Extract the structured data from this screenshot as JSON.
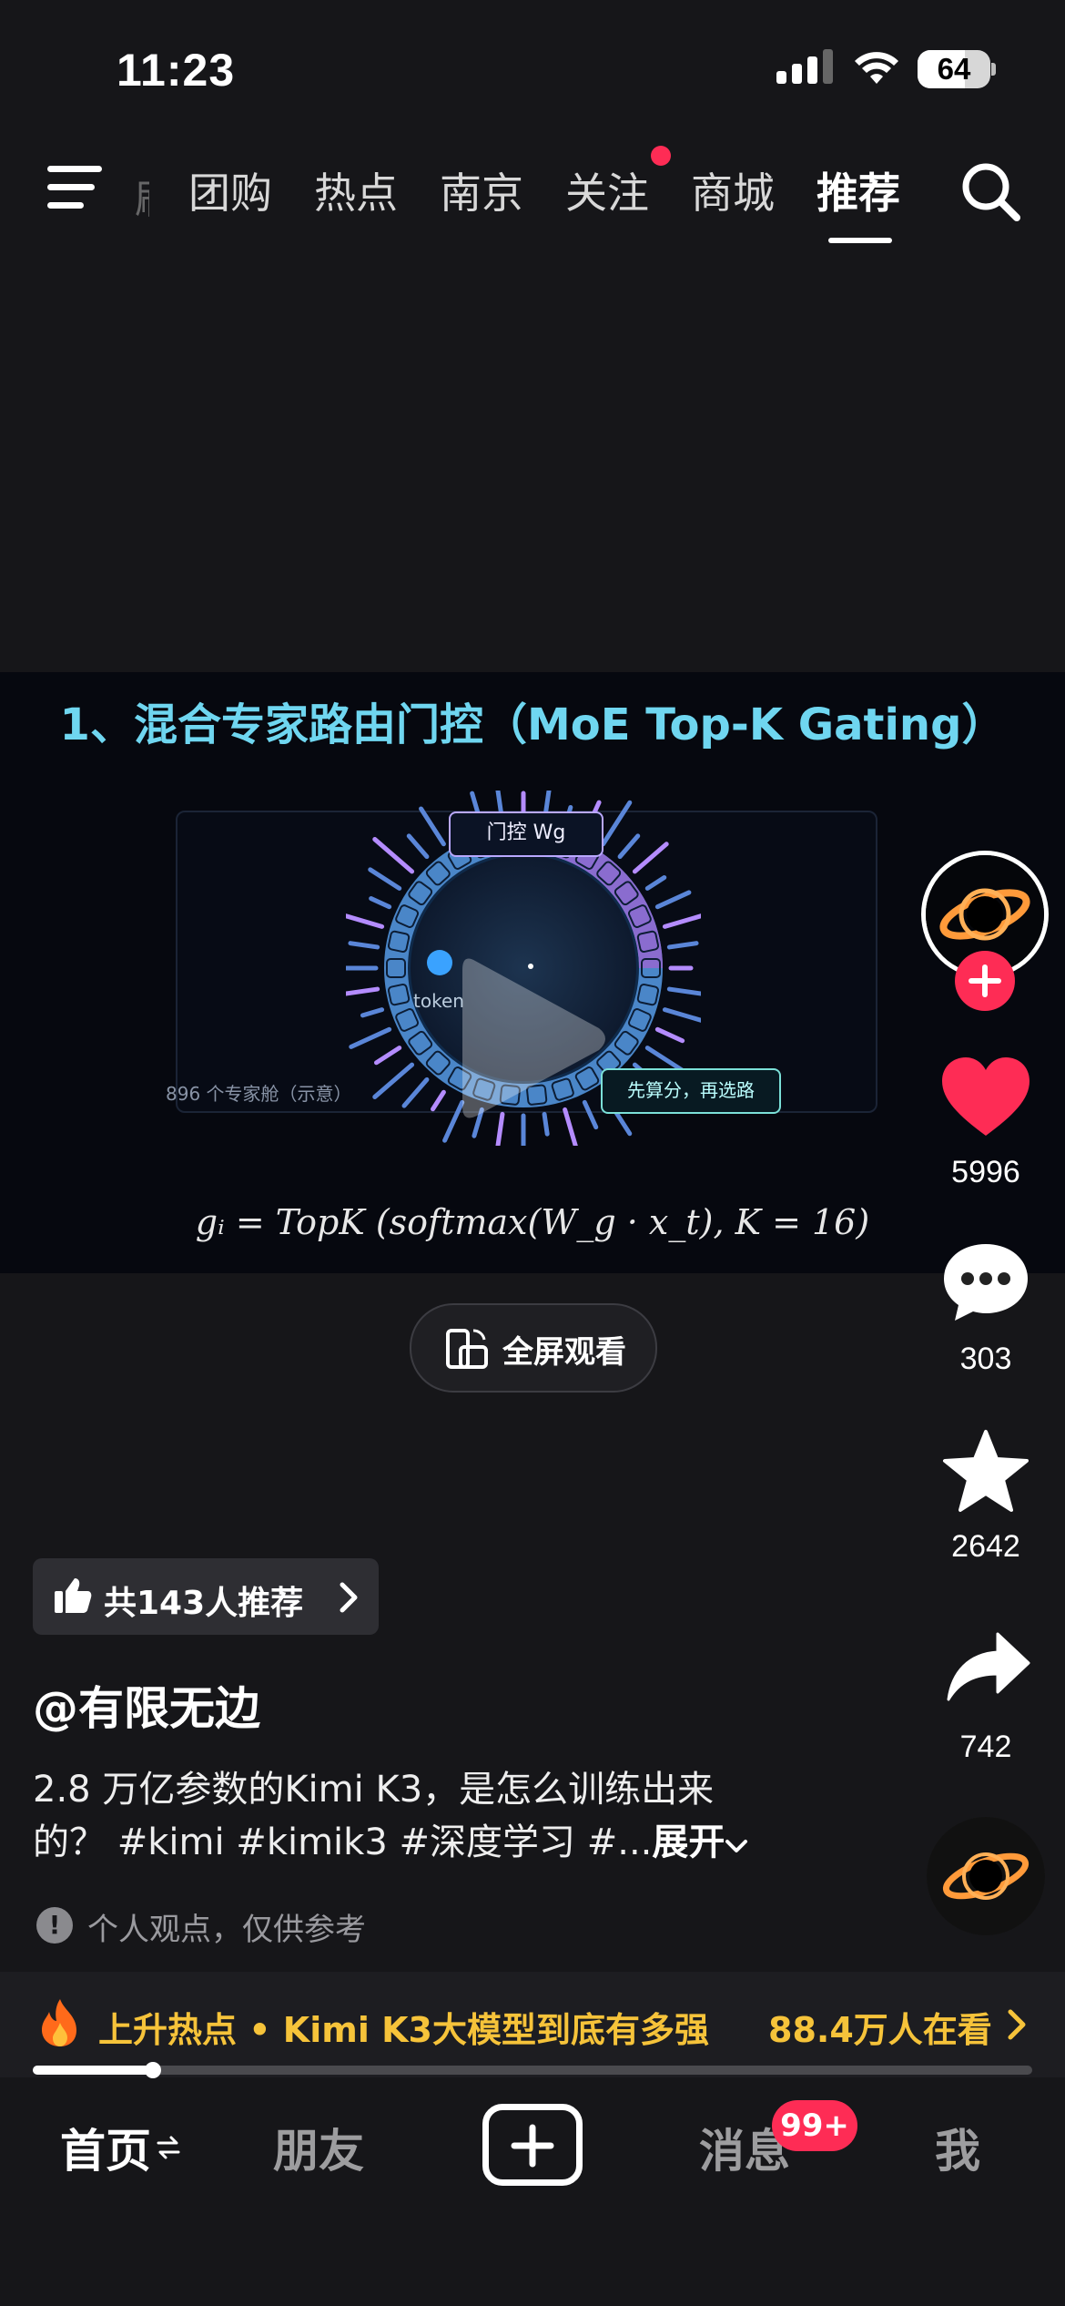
{
  "status_bar": {
    "time": "11:23",
    "battery": "64"
  },
  "top_nav": {
    "faded_tab": "刷",
    "tabs": [
      "团购",
      "热点",
      "南京",
      "关注",
      "商城",
      "推荐"
    ],
    "active_tab": "推荐"
  },
  "video": {
    "title": "1、混合专家路由门控（MoE Top-K Gating）",
    "gate_label": "门控 Wg",
    "token_label": "token",
    "experts_label": "896 个专家舱（示意）",
    "pick_label": "先算分，再选路",
    "formula": "gᵢ = TopK (softmax(W_g · x_t), K = 16)"
  },
  "fullscreen_label": "全屏观看",
  "actions": {
    "likes": "5996",
    "comments": "303",
    "favorites": "2642",
    "shares": "742"
  },
  "recommend_pill": "共143人推荐",
  "author": "@有限无边",
  "description": "2.8 万亿参数的Kimi K3，是怎么训练出来的？ #kimi #kimik3 #深度学习 #...",
  "expand_label": "展开",
  "notice": "个人观点，仅供参考",
  "hot_bar": {
    "text": "上升热点 • Kimi K3大模型到底有多强",
    "viewers": "88.4万人在看",
    "progress": 0.12
  },
  "bottom_tabs": {
    "home": "首页",
    "friends": "朋友",
    "messages": "消息",
    "me": "我",
    "badge": "99+"
  },
  "colors": {
    "accent_red": "#fe2c55",
    "hot_yellow": "#f6c33a",
    "title_cyan": "#6fd6f0"
  }
}
